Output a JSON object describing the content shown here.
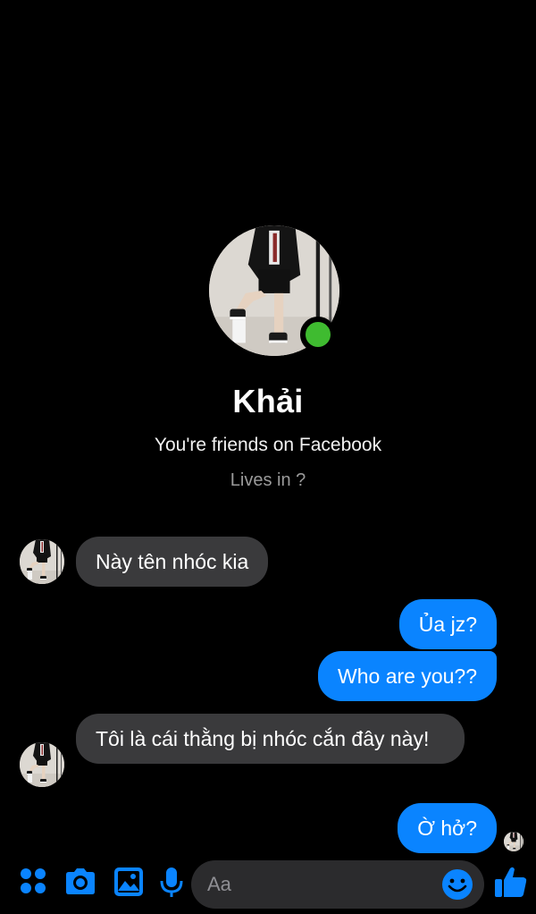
{
  "profile": {
    "name": "Khải",
    "subtitle": "You're friends on Facebook",
    "lives_in": "Lives in ?",
    "online": true
  },
  "messages": [
    {
      "from": "them",
      "text": "Này tên nhóc kia"
    },
    {
      "from": "me",
      "text": "Ủa jz?"
    },
    {
      "from": "me",
      "text": "Who are you??"
    },
    {
      "from": "them",
      "text": "Tôi là cái thằng bị nhóc cắn đây này!"
    },
    {
      "from": "me",
      "text": "Ờ hở?"
    }
  ],
  "composer": {
    "placeholder": "Aa",
    "icons": [
      "menu-grid-icon",
      "camera-icon",
      "gallery-icon",
      "microphone-icon",
      "emoji-icon",
      "thumbs-up-icon"
    ]
  },
  "colors": {
    "accent": "#0a84ff",
    "incoming_bubble": "#3a3a3c",
    "online": "#3fbb30",
    "background": "#000000"
  }
}
